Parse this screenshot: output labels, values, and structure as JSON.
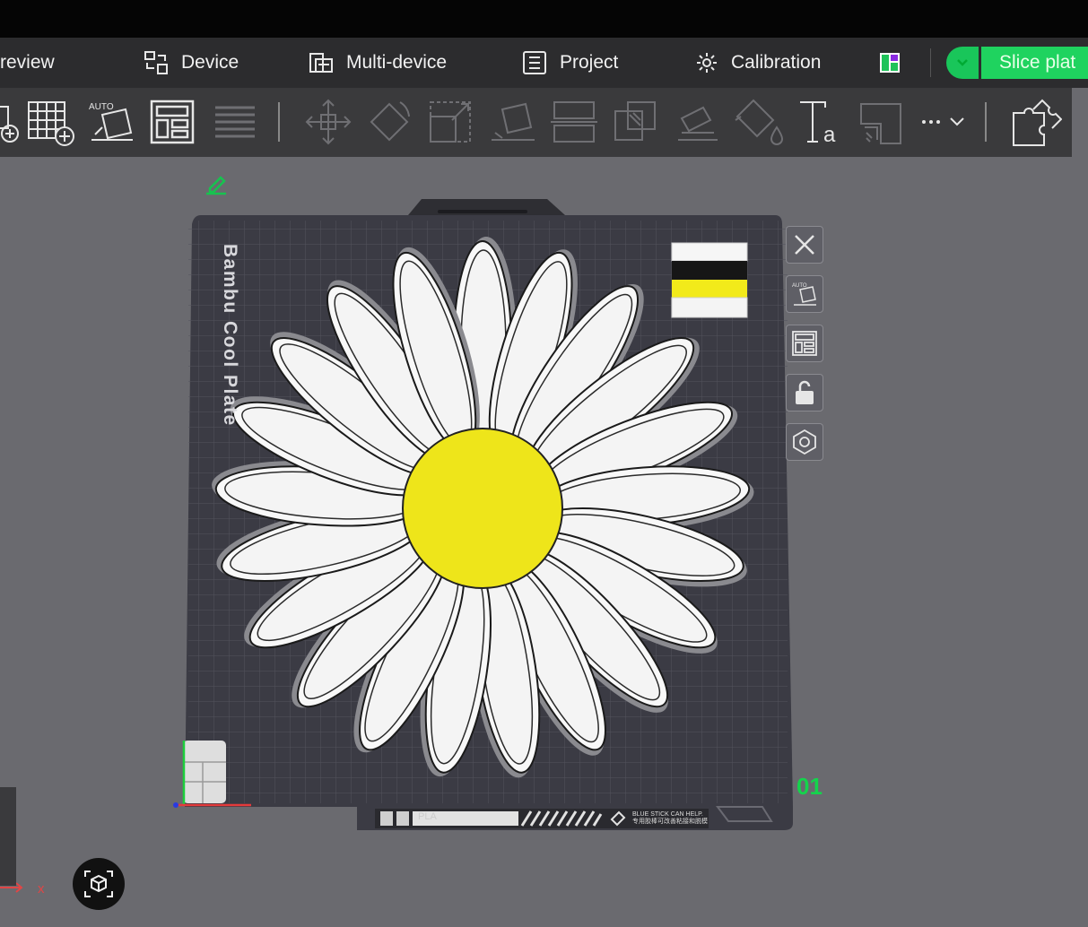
{
  "tabs": {
    "preview": "review",
    "device": "Device",
    "multi_device": "Multi-device",
    "project": "Project",
    "calibration": "Calibration"
  },
  "slice_button": "Slice plat",
  "plate": {
    "name": "Bambu Cool Plate",
    "number": "01",
    "filament": "PLA",
    "warning_line1": "BLUE STICK CAN HELP.",
    "warning_line2": "专用胶棒可改善粘接和脱模"
  },
  "axis_label": "x",
  "colors": {
    "accent_green": "#1fd35f",
    "petal": "#f4f4f4",
    "center": "#eee51a",
    "bed": "#3b3b44"
  }
}
